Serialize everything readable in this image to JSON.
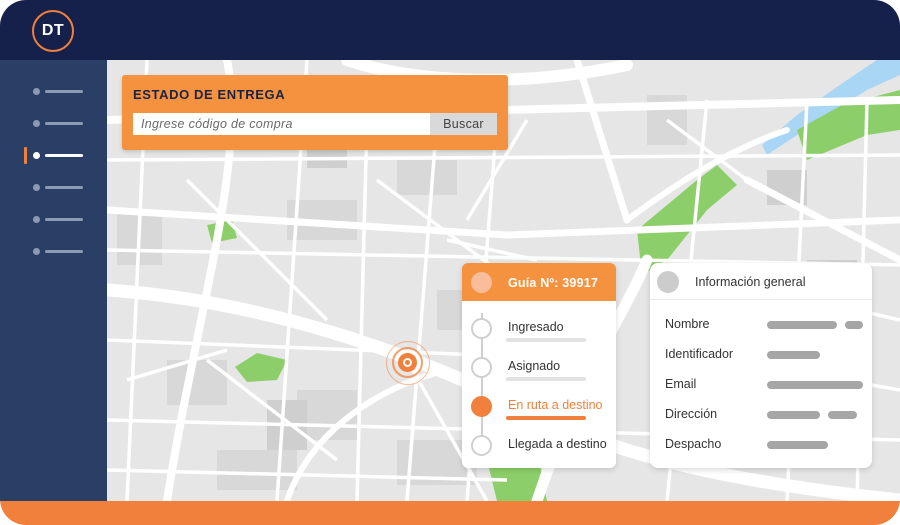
{
  "header": {
    "logo_text": "DT"
  },
  "sidebar": {
    "items": [
      {
        "name": "menu-item-1",
        "active": false
      },
      {
        "name": "menu-item-2",
        "active": false
      },
      {
        "name": "menu-item-3",
        "active": true
      },
      {
        "name": "menu-item-4",
        "active": false
      },
      {
        "name": "menu-item-5",
        "active": false
      },
      {
        "name": "menu-item-6",
        "active": false
      }
    ]
  },
  "search": {
    "title": "ESTADO DE ENTREGA",
    "placeholder": "Ingrese código de compra",
    "button_label": "Buscar"
  },
  "tracking": {
    "title": "Guía Nº: 39917",
    "steps": [
      {
        "label": "Ingresado",
        "active": false
      },
      {
        "label": "Asignado",
        "active": false
      },
      {
        "label": "En ruta a destino",
        "active": true
      },
      {
        "label": "Llegada a destino",
        "active": false
      }
    ]
  },
  "info": {
    "title": "Información general",
    "fields": [
      {
        "label": "Nombre"
      },
      {
        "label": "Identificador"
      },
      {
        "label": "Email"
      },
      {
        "label": "Dirección"
      },
      {
        "label": "Despacho"
      }
    ]
  },
  "colors": {
    "accent": "#f0803c",
    "header_bg": "#15214a",
    "sidebar_bg": "#2a3f66",
    "park_green": "#8ccf6a",
    "water_blue": "#a9d6f5"
  },
  "icons": {
    "pin": "location-pin-icon"
  }
}
